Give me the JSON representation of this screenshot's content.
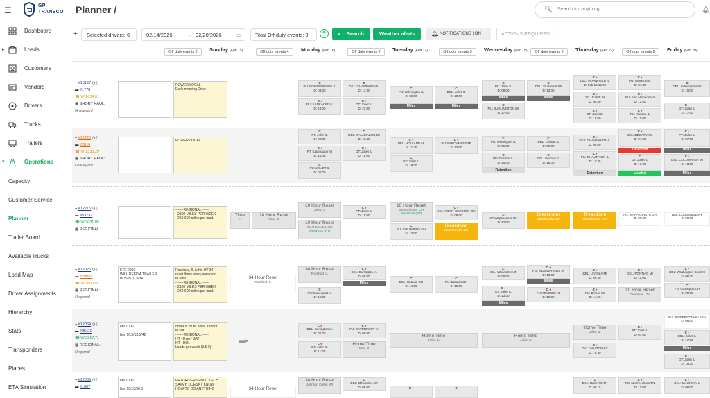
{
  "brand": {
    "line1": "GP",
    "line2": "TRANSCO"
  },
  "sidebar": {
    "items": [
      {
        "label": "Dashboard",
        "icon": "dashboard-icon"
      },
      {
        "label": "Loads",
        "icon": "box-icon"
      },
      {
        "label": "Customers",
        "icon": "customers-icon"
      },
      {
        "label": "Vendors",
        "icon": "vendors-icon"
      },
      {
        "label": "Drivers",
        "icon": "steering-wheel-icon"
      },
      {
        "label": "Trucks",
        "icon": "truck-icon"
      },
      {
        "label": "Trailers",
        "icon": "trailer-icon"
      },
      {
        "label": "Operations",
        "icon": "operations-icon"
      }
    ],
    "subitems": [
      "Capacity",
      "Customer Service",
      "Planner",
      "Trailer Board",
      "Available Trucks",
      "Load Map",
      "Driver Assignments",
      "Hierarchy",
      "Stats",
      "Transponders",
      "Places",
      "ETA Simulation"
    ]
  },
  "header": {
    "title": "Planner /",
    "search_placeholder": "Search for anything"
  },
  "toolbar": {
    "selected_drivers": "Selected drivers: 6",
    "date_from": "02/14/2026",
    "date_sep": "→",
    "date_to": "02/20/2026",
    "total_off_duty": "Total Off duty events: 9",
    "search_label": "Search",
    "weather_label": "Weather alerts",
    "notifications_label": "NOTIFICATIONS | ON",
    "actions_placeholder": "ACTIONS REQUIRED"
  },
  "days": [
    {
      "name": "Sunday",
      "date": "(Feb 15)",
      "off": "Off duty events 2"
    },
    {
      "name": "Monday",
      "date": "(Feb 16)",
      "off": "Off duty events 4"
    },
    {
      "name": "Tuesday",
      "date": "(Feb 17)",
      "off": "Off duty events 2"
    },
    {
      "name": "Wednesday",
      "date": "(Feb 18)",
      "off": "Off duty events 3"
    },
    {
      "name": "Thursday",
      "date": "(Feb 19)",
      "off": "Off duty events 2"
    },
    {
      "name": "Friday",
      "date": "(Feb 20)",
      "off": "Off duty events 2"
    }
  ],
  "drivers": [
    {
      "id": "#12157",
      "truck": "#1778",
      "phone": "W 1434.01",
      "type": "SHORT HAUL:",
      "shift": "Graveyard",
      "note1": "",
      "note2": "POWER LOCAL\nEarly morning Drive"
    },
    {
      "id": "#12220",
      "truck": "#2810",
      "phone": "W 1333.29",
      "type": "SHORT HAUL:",
      "shift": "Graveyard",
      "note1": "",
      "note2": "POWER LOCAL"
    },
    {
      "id": "#12215",
      "truck": "#53737",
      "phone": "W 2001.85",
      "type": "REGIONAL",
      "shift": "",
      "note1": "",
      "note2": "-------REGIONAL-------\n- 2100 MILES PER WEEK\n- 250-600 miles per load."
    },
    {
      "id": "#12026",
      "truck": "#28039",
      "phone": "W 1800.82",
      "type": "REGIONAL:",
      "shift": "Regional",
      "note1": "ETE 0900\nWILL NEED A TRAILER\nHOS 8/10.5/34",
      "note2": "Rockford, IL is his HT 34\nreset there every weekend\nto refill.\n-------REGIONAL-------\n- 2100 MILES PER WEEK\n- 250-600 miles per load."
    },
    {
      "id": "#12064",
      "truck": "#25110",
      "phone": "W 2317.71",
      "type": "REGIONAL:",
      "shift": "Regional",
      "note1": "ete 1000\n\nhos 10.5/13.5/42",
      "note2": "driver is mute. uses a robot\nto talk.\n-------REGIONAL-------\nHT - Every SAT\nHT - HOL\nLoads per week (3.5-6)"
    },
    {
      "id": "#12068",
      "truck": "#1607",
      "phone": "",
      "type": "",
      "shift": "",
      "note1": "ete 1000\n\nhos 10/13/36.5",
      "note2": "ERTDRIVER IS NOT TECH\nSAVVY. DOESNT KNOW\nHOW TO DO ANYTHING"
    }
  ],
  "cells": {
    "r1": [
      {
        "t": "C",
        "a": "PU: BOLINGBROOK IL",
        "b": "D: 08:30"
      },
      {
        "t": "C",
        "a": "DEL: CHAMPAIGN IL",
        "b": "D: 13:30"
      },
      {
        "t": "C",
        "a": "PU: KANKAKEE IL",
        "b": "D: 18:00"
      },
      {
        "t": "C",
        "a": "DT: Joliet IL",
        "b": "D: 21:00"
      },
      {
        "t": "C",
        "a": "PU: Wilmington IL",
        "b": "D: 08:00"
      },
      {
        "t": "C",
        "a": "DEL: Joliet IL",
        "b": "D: 20:00"
      },
      {
        "t": "C",
        "a": "PU: Joliet IL",
        "b": "D: 08:00"
      },
      {
        "t": "C",
        "a": "DEL: Sturtevant WI",
        "b": "D: 13:00"
      },
      {
        "t": "C",
        "a": "PU: BURLINGTON WI",
        "b": "D: 17:00"
      },
      {
        "t": "C",
        "a": "DEL: PLAINFIELD IL",
        "b": "D: Feb 18 16:00"
      },
      {
        "t": "C",
        "a": "PU: MORRIS IL",
        "b": "D: 04:30"
      },
      {
        "t": "C",
        "a": "DEL: DANE WI",
        "b": "D: 08:30"
      },
      {
        "t": "C",
        "a": "PU: Fort Atkinson WI",
        "b": "D: 12:00"
      },
      {
        "t": "C",
        "a": "DT: Joliet IL",
        "b": "D: 19:00"
      },
      {
        "t": "C",
        "a": "PU: Elwood IL",
        "b": "D: 10:00"
      },
      {
        "t": "C",
        "a": "DEL: Indianapolis IN",
        "b": "D: 15:00"
      },
      {
        "t": "C",
        "a": "DT: Joliet IL",
        "b": "D: 17:00"
      }
    ],
    "r2": [
      {
        "t": "C",
        "a": "PT: Joliet IL",
        "b": "D: 08:30"
      },
      {
        "t": "C",
        "a": "DEL: KALAMAZOO MI",
        "b": "D: 13:30"
      },
      {
        "t": "C",
        "a": "PT: Kalamazoo MI",
        "b": "D: 14:45"
      },
      {
        "t": "C",
        "a": "DT: Joliet IL",
        "b": "D: 18:00"
      },
      {
        "t": "C",
        "a": "PU: JOLIET IL",
        "b": "D: 06:00"
      },
      {
        "t": "C",
        "a": "DEL: HOLLAND MI",
        "b": "D: 11:30"
      },
      {
        "t": "C",
        "a": "PU: PARCHMENT MI",
        "b": "D: 13:00"
      },
      {
        "t": "C",
        "a": "DT: Joliet IL",
        "b": "D: 18:00"
      },
      {
        "t": "C",
        "a": "PU: Wilmington IL",
        "b": "D: 06:00"
      },
      {
        "t": "C",
        "a": "DEL: Urbana IL",
        "b": "D: 09:00"
      },
      {
        "t": "C",
        "a": "PU: Decatur IL",
        "b": "D: 14:00"
      },
      {
        "t": "C",
        "a": "DEL: Decatur IL",
        "b": "D: 16:00"
      },
      {
        "t": "C",
        "a": "DEL: CHANNAHON IL",
        "b": "D: 06:00"
      },
      {
        "t": "C",
        "a": "DEL: DECATUR IL",
        "b": "D: 04:30"
      },
      {
        "t": "C",
        "a": "PU: CHAMPAIGN IL",
        "b": "D: 11:30"
      },
      {
        "t": "C",
        "a": "DT: Joliet IL",
        "b": "D: 13:00"
      },
      {
        "t": "C",
        "a": "PT: Joliet IL",
        "b": "D: 07:00"
      },
      {
        "t": "C",
        "a": "DEL: COLDWATER MI",
        "b": "D: 13:00"
      }
    ],
    "r3": [
      {
        "t": "C",
        "a": "PT: Joliet IL",
        "b": "D: 15:00"
      },
      {
        "t": "C",
        "a": "DEL: WEST CHESTER OH",
        "b": "D: 08:00"
      },
      {
        "t": "C",
        "a": "PU: COLUMBUS OH",
        "b": "D: 13:00"
      },
      {
        "t": "C",
        "a": "DT: Wapakoneta OH",
        "b": "D: 17:00"
      },
      {
        "t": "",
        "a": "PU: WAPAKONETA OH",
        "b": "D: 09:00"
      },
      {
        "t": "",
        "a": "DEL: LOUISVILLE KY",
        "b": "D: 09:00"
      }
    ],
    "r4": [
      {
        "t": "C",
        "a": "DEL: Burlington IA",
        "b": "D: 08:00"
      },
      {
        "t": "C",
        "a": "PU: Davenport IA",
        "b": "D: 16:00"
      },
      {
        "t": "C",
        "a": "DEL: Batavia OH",
        "b": "D: 14:00"
      },
      {
        "t": "C",
        "a": "PU: Batavia OH",
        "b": "D: 15:00"
      },
      {
        "t": "C",
        "a": "DEL: Whitestown IN",
        "b": "D: 08:00"
      },
      {
        "t": "C",
        "a": "PU: INDIANAPOLIS IN",
        "b": "D: 13:30"
      },
      {
        "t": "C",
        "a": "DT: Joliet IL",
        "b": "D: 13:30"
      },
      {
        "t": "C",
        "a": "PU: MINOOKA IL",
        "b": "D: 15:00"
      },
      {
        "t": "C",
        "a": "DEL: LIVONIA MI",
        "b": "D: 08:30"
      },
      {
        "t": "C",
        "a": "DEL: PONTIAC MI",
        "b": "D: 11:00"
      },
      {
        "t": "C",
        "a": "PU: Detroit MI",
        "b": "D: 14:00"
      },
      {
        "t": "C",
        "a": "DEL: Washington Court H",
        "b": "D: 06:30"
      },
      {
        "t": "C",
        "a": "PU: Groveport OH",
        "b": "D: 09:00"
      }
    ],
    "r5": [
      {
        "t": "C",
        "a": "DEL: Burlington IA",
        "b": "D: 06:00"
      },
      {
        "t": "C",
        "a": "PU: DAVENPORT IA",
        "b": "D: 08:00"
      },
      {
        "t": "C",
        "a": "DT: Joliet IL",
        "b": "D: 11:30"
      },
      {
        "t": "C",
        "a": "PT: Joliet IL",
        "b": "D: 07:00"
      },
      {
        "t": "C",
        "a": "DEL: WALTON KY",
        "b": "D: 16:30"
      },
      {
        "t": "",
        "a": "PU: JEFFERSONVILLE IN",
        "b": "D: 08:00"
      },
      {
        "t": "C",
        "a": "DEL: Joliet IL",
        "b": "D: 17:30"
      },
      {
        "t": "C",
        "a": "DT: Joliet IL",
        "b": "D: 19:30"
      }
    ],
    "r6": [
      {
        "t": "C",
        "a": "DEL: Milwaukee WI",
        "b": "D: 08:00"
      },
      {
        "t": "C",
        "a": "",
        "b": ""
      },
      {
        "t": "C",
        "a": "",
        "b": ""
      },
      {
        "t": "C",
        "a": "DEL: Nashville TN",
        "b": "D: 08:15"
      },
      {
        "t": "C",
        "a": "PU: Murfreesboro TN",
        "b": "D: 11:00"
      },
      {
        "t": "C",
        "a": "DEL: MINOOKA IL",
        "b": "D: 06:00"
      }
    ]
  },
  "blocks": {
    "hour_reset": "10 Hour Reset",
    "hour34_reset": "34 Hour Reset",
    "home_time": "Home Time",
    "breakdown": "Breakdown",
    "joliet": "Joliet, IL",
    "rockford": "Rockford, IL",
    "west_chester": "West Chester, OH",
    "westrock": "WestRock (RT)",
    "wapakoneta": "Wapakoneta, OH",
    "davenport": "Davenport, IA",
    "groveport": "Groveport, OH",
    "johnson_creek": "Johnson Creek, WI",
    "time": "Time",
    "miles": "Miles",
    "detention": "Detention",
    "loaded": "Loaded",
    "il": "IL"
  }
}
